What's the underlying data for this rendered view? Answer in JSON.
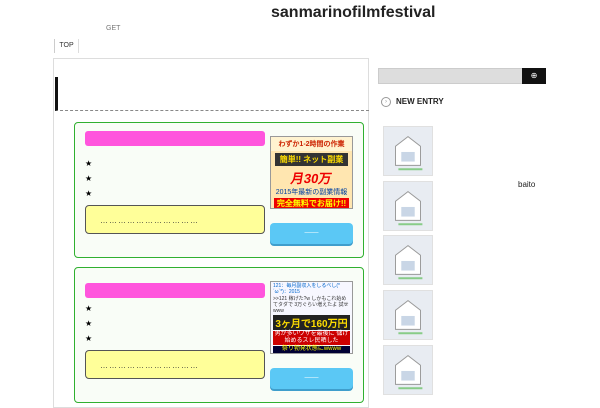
{
  "header": {
    "title": "sanmarinofilmfestival",
    "description": "GET"
  },
  "nav": {
    "items": [
      "TOP"
    ]
  },
  "boxes": [
    {
      "stars": [
        "★",
        "★",
        "★"
      ],
      "input_text": "……………………………",
      "button_label": "——",
      "ad": {
        "l1": "わずか1-2時間の作業",
        "l2": "簡単!! ネット副業",
        "l3": "月30万",
        "l4": "2015年最新の副業情報",
        "l5": "完全無料でお届け!!"
      }
    },
    {
      "stars": [
        "★",
        "★",
        "★"
      ],
      "input_text": "……………………………",
      "button_label": "——",
      "ad": {
        "l1": "121：毎月副収入をしるべし(*´ω`*)：2015",
        "l2": ">>121 稼げた?w しかもこれ始めてタダで 3万ぐらい増えたよ 試せwww",
        "l3": "3ヶ月で160万円",
        "l4": "男が多いワザを最後に 儲け始めるスレ民晒した",
        "l5": "祭り勃発状態にwwww"
      }
    }
  ],
  "sidebar": {
    "search_button": "⊕",
    "new_entry_title": "NEW ENTRY",
    "entries": [
      {
        "label": ""
      },
      {
        "label": "baito"
      },
      {
        "label": ""
      },
      {
        "label": ""
      },
      {
        "label": ""
      }
    ]
  }
}
